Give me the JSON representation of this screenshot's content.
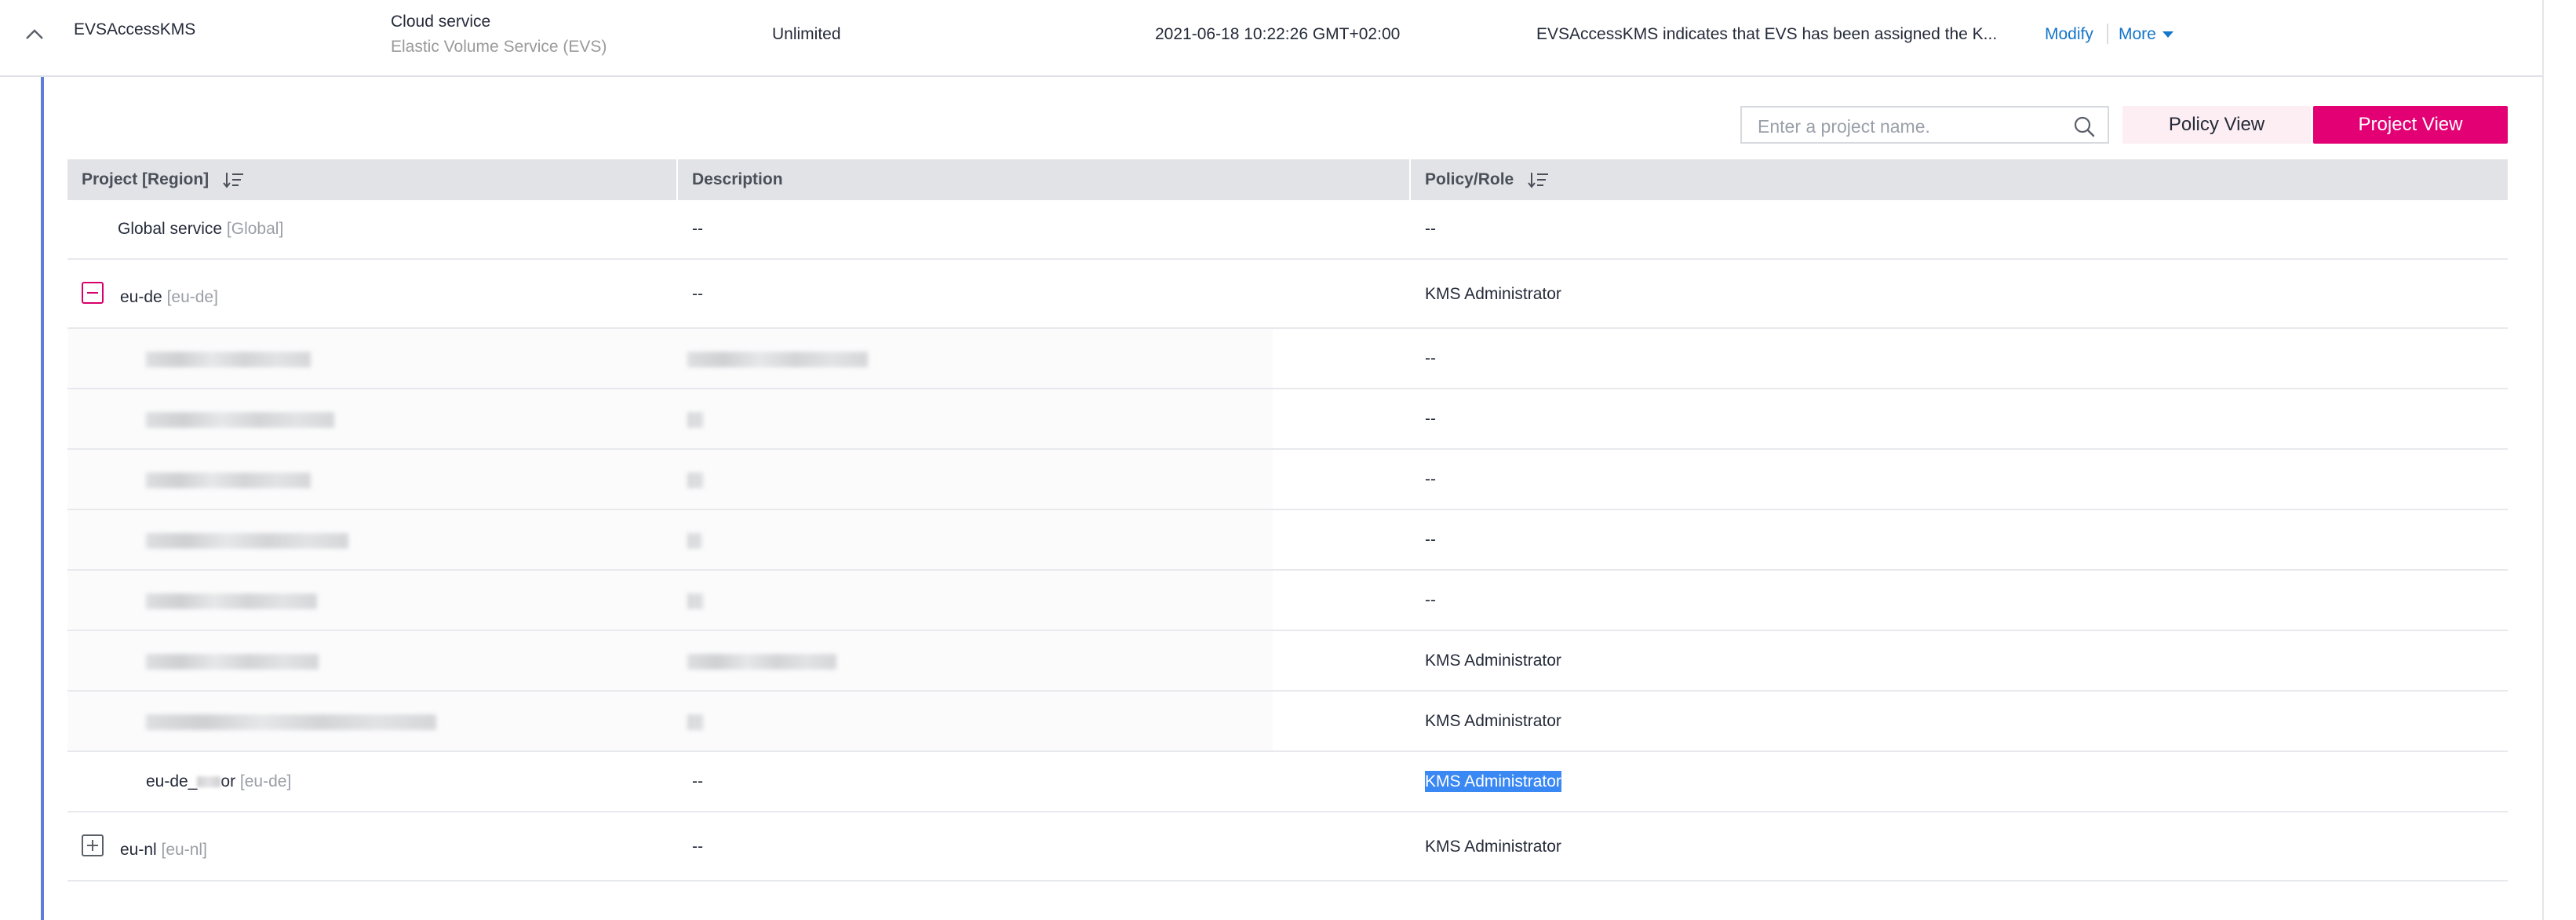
{
  "agency": {
    "name": "EVSAccessKMS",
    "type_primary": "Cloud service",
    "type_secondary": "Elastic Volume Service (EVS)",
    "duration": "Unlimited",
    "created": "2021-06-18 10:22:26 GMT+02:00",
    "description": "EVSAccessKMS indicates that EVS has been assigned the K...",
    "op_modify": "Modify",
    "op_more": "More"
  },
  "toolbar": {
    "search_placeholder": "Enter a project name.",
    "policy_view_label": "Policy View",
    "project_view_label": "Project View"
  },
  "colors": {
    "accent": "#e20074",
    "accent_light": "#fdeef3",
    "link": "#1476c9",
    "panel_border": "#5f7ed8",
    "selection": "#3a88f4"
  },
  "table": {
    "headers": {
      "project": "Project [Region]",
      "description": "Description",
      "policy": "Policy/Role"
    },
    "rows": [
      {
        "name": "Global service",
        "region": "[Global]",
        "description": "--",
        "policy": "--"
      },
      {
        "name": "eu-de",
        "region": "[eu-de]",
        "description": "--",
        "policy": "KMS Administrator"
      },
      {
        "description": "",
        "policy": "--"
      },
      {
        "description": "",
        "policy": "--"
      },
      {
        "description": "",
        "policy": "--"
      },
      {
        "description": "",
        "policy": "--"
      },
      {
        "description": "",
        "policy": "--"
      },
      {
        "description": "",
        "policy": "KMS Administrator"
      },
      {
        "description": "",
        "policy": "KMS Administrator"
      },
      {
        "name_prefix": "eu-de_",
        "name_suffix": "or",
        "region": "[eu-de]",
        "description": "--",
        "policy": "KMS Administrator"
      },
      {
        "name": "eu-nl",
        "region": "[eu-nl]",
        "description": "--",
        "policy": "KMS Administrator"
      }
    ]
  }
}
